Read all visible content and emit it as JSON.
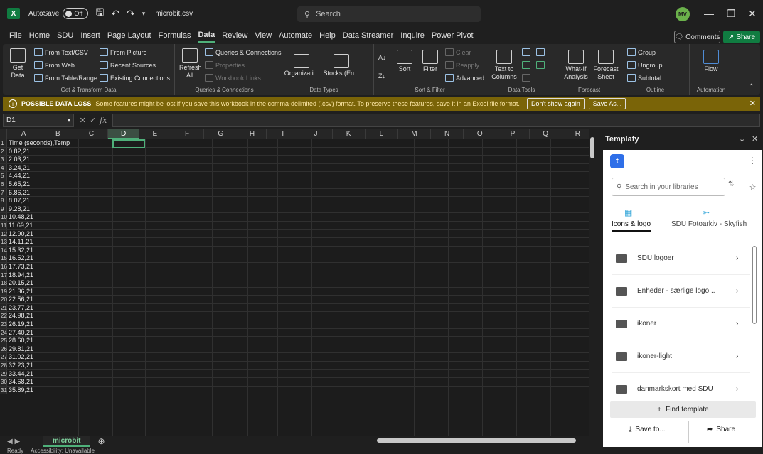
{
  "titlebar": {
    "autosave_label": "AutoSave",
    "autosave_state": "Off",
    "filename": "microbit.csv",
    "search_placeholder": "Search",
    "avatar_initials": "MV"
  },
  "menu": {
    "tabs": [
      "File",
      "Home",
      "SDU",
      "Insert",
      "Page Layout",
      "Formulas",
      "Data",
      "Review",
      "View",
      "Automate",
      "Help",
      "Data Streamer",
      "Inquire",
      "Power Pivot"
    ],
    "active": "Data",
    "comments": "Comments",
    "share": "Share"
  },
  "ribbon": {
    "get_data": "Get",
    "get_data2": "Data",
    "from_text": "From Text/CSV",
    "from_web": "From Web",
    "from_table": "From Table/Range",
    "from_picture": "From Picture",
    "recent_sources": "Recent Sources",
    "existing_connections": "Existing Connections",
    "group_get": "Get & Transform Data",
    "refresh": "Refresh",
    "refresh2": "All",
    "queries": "Queries & Connections",
    "properties": "Properties",
    "workbook_links": "Workbook Links",
    "group_queries": "Queries & Connections",
    "organization": "Organizati...",
    "stocks": "Stocks (En...",
    "group_types": "Data Types",
    "sort": "Sort",
    "filter": "Filter",
    "clear": "Clear",
    "reapply": "Reapply",
    "advanced": "Advanced",
    "group_sort": "Sort & Filter",
    "text_to_columns": "Text to",
    "text_to_columns2": "Columns",
    "group_tools": "Data Tools",
    "what_if": "What-If",
    "what_if2": "Analysis",
    "forecast_sheet": "Forecast",
    "forecast_sheet2": "Sheet",
    "group_forecast": "Forecast",
    "group": "Group",
    "ungroup": "Ungroup",
    "subtotal": "Subtotal",
    "group_outline": "Outline",
    "flow": "Flow",
    "group_automation": "Automation"
  },
  "warning": {
    "title": "POSSIBLE DATA LOSS",
    "text": "Some features might be lost if you save this workbook in the comma-delimited (.csv) format. To preserve these features, save it in an Excel file format.",
    "dont_show": "Don't show again",
    "save_as": "Save As..."
  },
  "formula": {
    "namebox": "D1",
    "fx": "fx"
  },
  "grid": {
    "columns": [
      "A",
      "B",
      "C",
      "D",
      "E",
      "F",
      "G",
      "H",
      "I",
      "J",
      "K",
      "L",
      "M",
      "N",
      "O",
      "P",
      "Q",
      "R"
    ],
    "active_column": "D",
    "rows": [
      "Time (seconds),Temp",
      "0.82,21",
      "2.03,21",
      "3.24,21",
      "4.44,21",
      "5.65,21",
      "6.86,21",
      "8.07,21",
      "9.28,21",
      "10.48,21",
      "11.69,21",
      "12.90,21",
      "14.11,21",
      "15.32,21",
      "16.52,21",
      "17.73,21",
      "18.94,21",
      "20.15,21",
      "21.36,21",
      "22.56,21",
      "23.77,21",
      "24.98,21",
      "26.19,21",
      "27.40,21",
      "28.60,21",
      "29.81,21",
      "31.02,21",
      "32.23,21",
      "33.44,21",
      "34.68,21",
      "35.89,21"
    ]
  },
  "sheets": {
    "active": "microbit"
  },
  "status": {
    "ready": "Ready",
    "accessibility": "Accessibility: Unavailable"
  },
  "templafy": {
    "title": "Templafy",
    "search_placeholder": "Search in your libraries",
    "tab_icons": "Icons & logo",
    "tab_foto": "SDU Fotoarkiv - Skyfish",
    "items": [
      "SDU logoer",
      "Enheder - særlige logo...",
      "ikoner",
      "ikoner-light",
      "danmarkskort med SDU"
    ],
    "find_template": "Find template",
    "save_to": "Save to...",
    "share": "Share"
  }
}
